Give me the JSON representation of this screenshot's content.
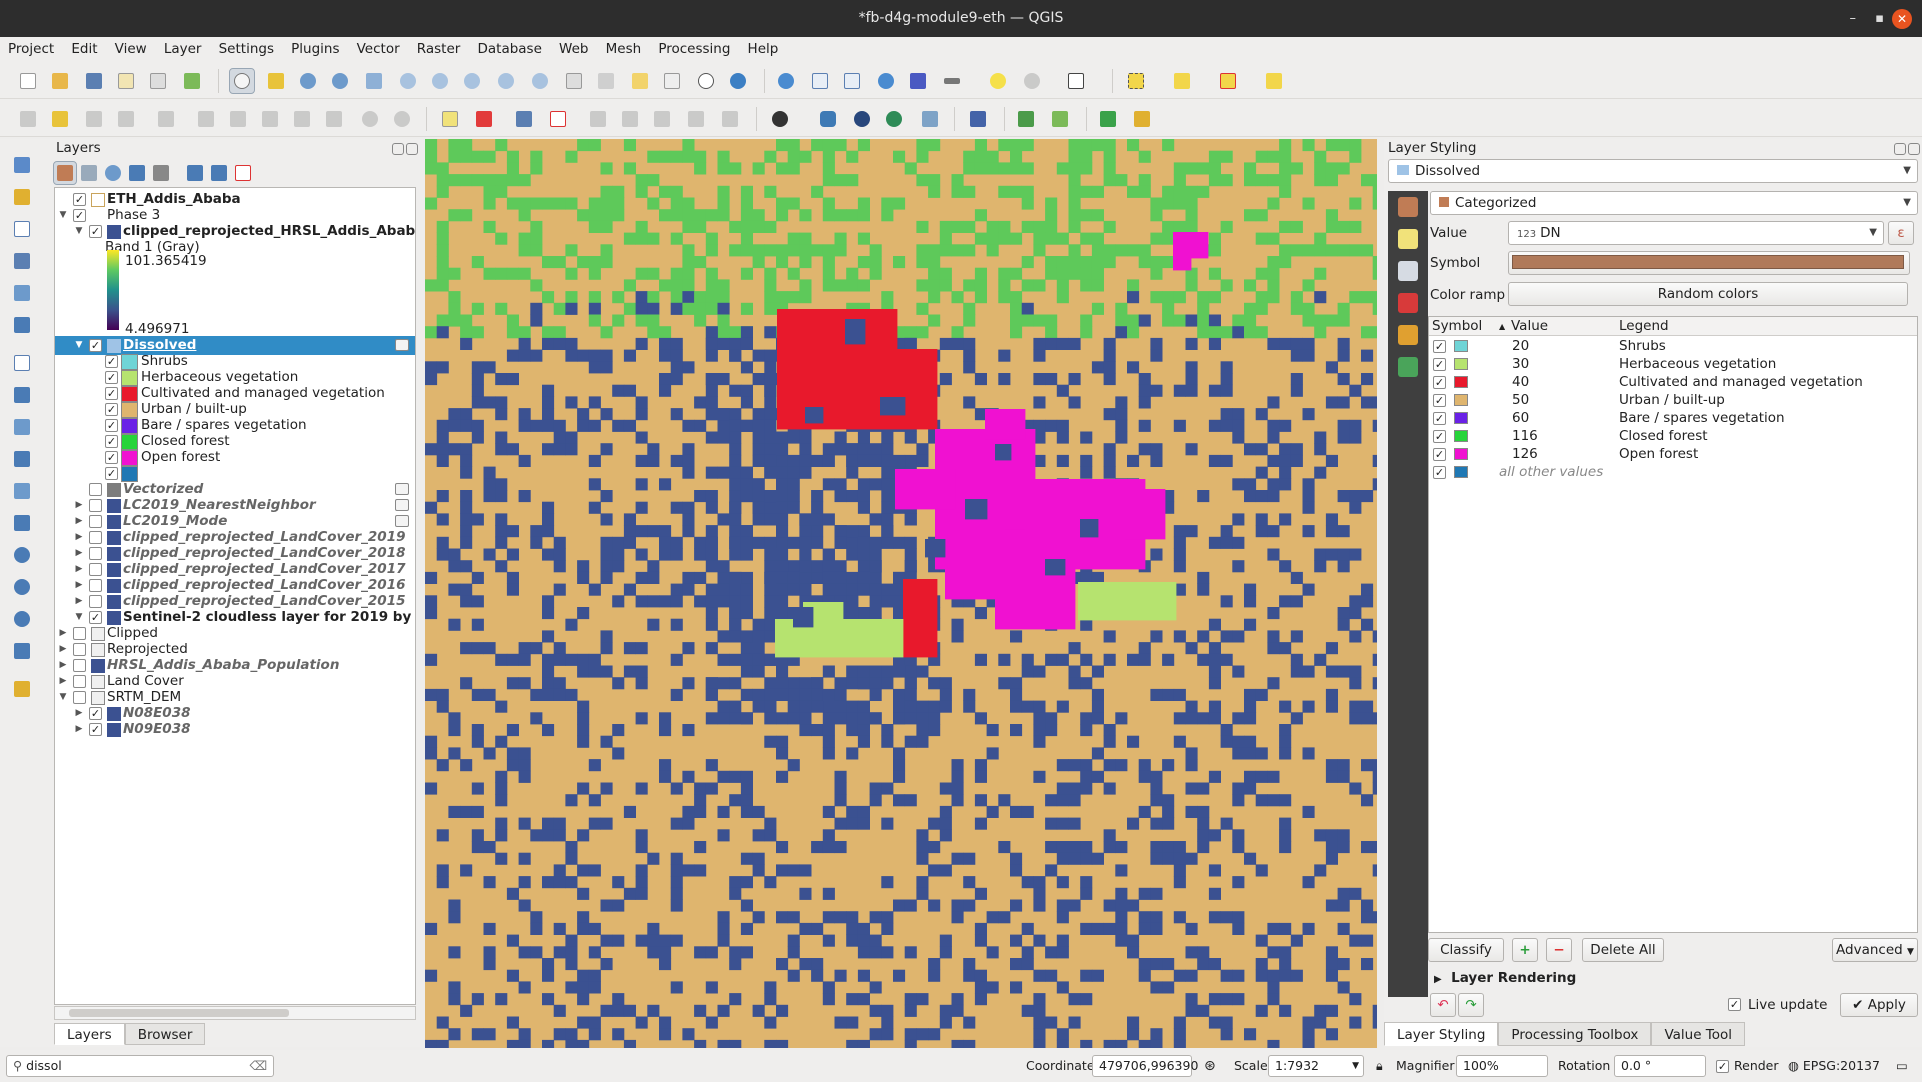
{
  "window": {
    "title": "*fb-d4g-module9-eth — QGIS",
    "min": "–",
    "max": "▪",
    "close": "✕"
  },
  "menu": [
    "Project",
    "Edit",
    "View",
    "Layer",
    "Settings",
    "Plugins",
    "Vector",
    "Raster",
    "Database",
    "Web",
    "Mesh",
    "Processing",
    "Help"
  ],
  "layers_panel": {
    "title": "Layers",
    "tabs": [
      "Layers",
      "Browser"
    ],
    "tree": {
      "eth_addis": "ETH_Addis_Ababa",
      "phase3": "Phase 3",
      "hrsl_clipped": "clipped_reprojected_HRSL_Addis_Abab",
      "band": "Band 1 (Gray)",
      "band_max": "101.365419",
      "band_min": "4.496971",
      "dissolved": "Dissolved",
      "categories": [
        {
          "label": "Shrubs",
          "color": "#6fd4d6"
        },
        {
          "label": "Herbaceous vegetation",
          "color": "#b6e36f"
        },
        {
          "label": "Cultivated and managed vegetation",
          "color": "#e8192c"
        },
        {
          "label": "Urban / built-up",
          "color": "#dfb56e"
        },
        {
          "label": "Bare / spares vegetation",
          "color": "#6a21e6"
        },
        {
          "label": "Closed forest",
          "color": "#27d43a"
        },
        {
          "label": "Open forest",
          "color": "#f011d1"
        },
        {
          "label": "",
          "color": "#1f78b4"
        }
      ],
      "vectorized": "Vectorized",
      "lc_nearest": "LC2019_NearestNeighbor",
      "lc_mode": "LC2019_Mode",
      "lc2019": "clipped_reprojected_LandCover_2019",
      "lc2018": "clipped_reprojected_LandCover_2018",
      "lc2017": "clipped_reprojected_LandCover_2017",
      "lc2016": "clipped_reprojected_LandCover_2016",
      "lc2015": "clipped_reprojected_LandCover_2015",
      "sentinel": "Sentinel-2 cloudless layer for 2019 by",
      "clipped": "Clipped",
      "reprojected": "Reprojected",
      "hrsl_pop": "HRSL_Addis_Ababa_Population",
      "landcover": "Land Cover",
      "srtm": "SRTM_DEM",
      "n08": "N08E038",
      "n09": "N09E038"
    }
  },
  "style_panel": {
    "title": "Layer Styling",
    "layer": "Dissolved",
    "renderer": "Categorized",
    "value_label": "Value",
    "value_field": "DN",
    "value_field_type": "123",
    "symbol_label": "Symbol",
    "ramp_label": "Color ramp",
    "ramp": "Random colors",
    "columns": [
      "Symbol",
      "Value",
      "Legend"
    ],
    "rows": [
      {
        "value": "20",
        "legend": "Shrubs",
        "color": "#6fd4d6"
      },
      {
        "value": "30",
        "legend": "Herbaceous vegetation",
        "color": "#b6e36f"
      },
      {
        "value": "40",
        "legend": "Cultivated and managed vegetation",
        "color": "#e8192c"
      },
      {
        "value": "50",
        "legend": "Urban / built-up",
        "color": "#dfb56e"
      },
      {
        "value": "60",
        "legend": "Bare / spares vegetation",
        "color": "#6a21e6"
      },
      {
        "value": "116",
        "legend": "Closed forest",
        "color": "#27d43a"
      },
      {
        "value": "126",
        "legend": "Open forest",
        "color": "#f011d1"
      },
      {
        "value": "",
        "legend": "all other values",
        "color": "#1f78b4"
      }
    ],
    "classify": "Classify",
    "delete_all": "Delete All",
    "advanced": "Advanced",
    "layer_rendering": "Layer Rendering",
    "live_update": "Live update",
    "apply": "Apply",
    "tabs": [
      "Layer Styling",
      "Processing Toolbox",
      "Value Tool"
    ]
  },
  "statusbar": {
    "search": "dissol",
    "coordinate_label": "Coordinate",
    "coordinate": "479706,996390",
    "scale_label": "Scale",
    "scale": "1:7932",
    "magnifier_label": "Magnifier",
    "magnifier": "100%",
    "rotation_label": "Rotation",
    "rotation": "0.0 °",
    "render": "Render",
    "crs": "EPSG:20137"
  },
  "map": {
    "colors": {
      "urban": "#dfb56e",
      "water": "#3b5191",
      "herb": "#b6e36f",
      "green": "#5ec95a",
      "red": "#e8192c",
      "magenta": "#f011d1"
    }
  }
}
